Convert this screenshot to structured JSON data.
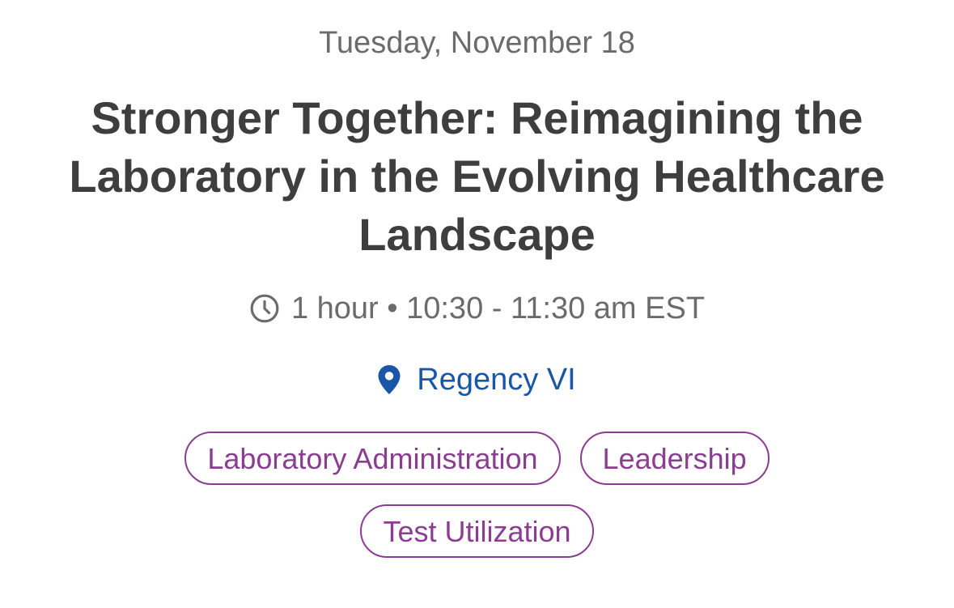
{
  "session": {
    "date": "Tuesday, November 18",
    "title": "Stronger Together: Reimagining the Laboratory in the Evolving Healthcare Landscape",
    "time": "1 hour • 10:30 - 11:30 am EST",
    "location": "Regency VI",
    "tags": [
      "Laboratory Administration",
      "Leadership",
      "Test Utilization"
    ]
  },
  "icons": {
    "time": "clock-icon",
    "location": "map-pin-icon"
  },
  "colors": {
    "text_primary": "#3e3e3e",
    "text_secondary": "#6b6b6b",
    "location": "#1a56a8",
    "tag": "#8a3d91",
    "background": "#ffffff"
  }
}
